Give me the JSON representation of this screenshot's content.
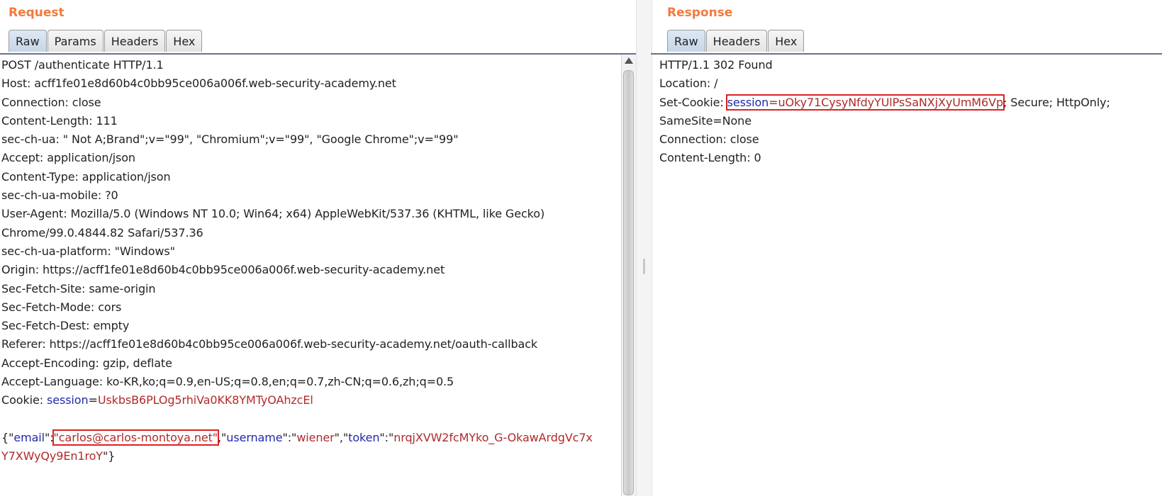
{
  "request": {
    "title": "Request",
    "tabs": [
      "Raw",
      "Params",
      "Headers",
      "Hex"
    ],
    "lines": [
      "POST /authenticate HTTP/1.1",
      "Host: acff1fe01e8d60b4c0bb95ce006a006f.web-security-academy.net",
      "Connection: close",
      "Content-Length: 111",
      "sec-ch-ua: \" Not A;Brand\";v=\"99\", \"Chromium\";v=\"99\", \"Google Chrome\";v=\"99\"",
      "Accept: application/json",
      "Content-Type: application/json",
      "sec-ch-ua-mobile: ?0",
      "User-Agent: Mozilla/5.0 (Windows NT 10.0; Win64; x64) AppleWebKit/537.36 (KHTML, like Gecko)",
      "Chrome/99.0.4844.82 Safari/537.36",
      "sec-ch-ua-platform: \"Windows\"",
      "Origin: https://acff1fe01e8d60b4c0bb95ce006a006f.web-security-academy.net",
      "Sec-Fetch-Site: same-origin",
      "Sec-Fetch-Mode: cors",
      "Sec-Fetch-Dest: empty",
      "Referer: https://acff1fe01e8d60b4c0bb95ce006a006f.web-security-academy.net/oauth-callback",
      "Accept-Encoding: gzip, deflate",
      "Accept-Language: ko-KR,ko;q=0.9,en-US;q=0.8,en;q=0.7,zh-CN;q=0.6,zh;q=0.5"
    ],
    "cookie": {
      "prefix": "Cookie: ",
      "name": "session",
      "eq": "=",
      "value": "UskbsB6PLOg5rhiVa0KK8YMTyOAhzcEl"
    },
    "body": {
      "open": "{\"",
      "k1": "email",
      "q1": "\":",
      "v1": "\"carlos@carlos-montoya.net\"",
      "sep1": ",\"",
      "k2": "username",
      "q2": "\":\"",
      "v2": "wiener",
      "sep2": "\",\"",
      "k3": "token",
      "q3": "\":\"",
      "v3a": "nrqjXVW2fcMYko_G-OkawArdgVc7x",
      "v3b": "Y7XWyQy9En1roY",
      "close": "\"}"
    }
  },
  "response": {
    "title": "Response",
    "tabs": [
      "Raw",
      "Headers",
      "Hex"
    ],
    "status": "HTTP/1.1 302 Found",
    "location": "Location: /",
    "set_cookie": {
      "prefix": "Set-Cookie: ",
      "name": "session",
      "eq": "=",
      "value": "uOky71CysyNfdyYUlPsSaNXjXyUmM6Vp",
      "suffix": "; Secure; HttpOnly;"
    },
    "samesite": "SameSite=None",
    "connection": "Connection: close",
    "content_length": "Content-Length: 0"
  }
}
